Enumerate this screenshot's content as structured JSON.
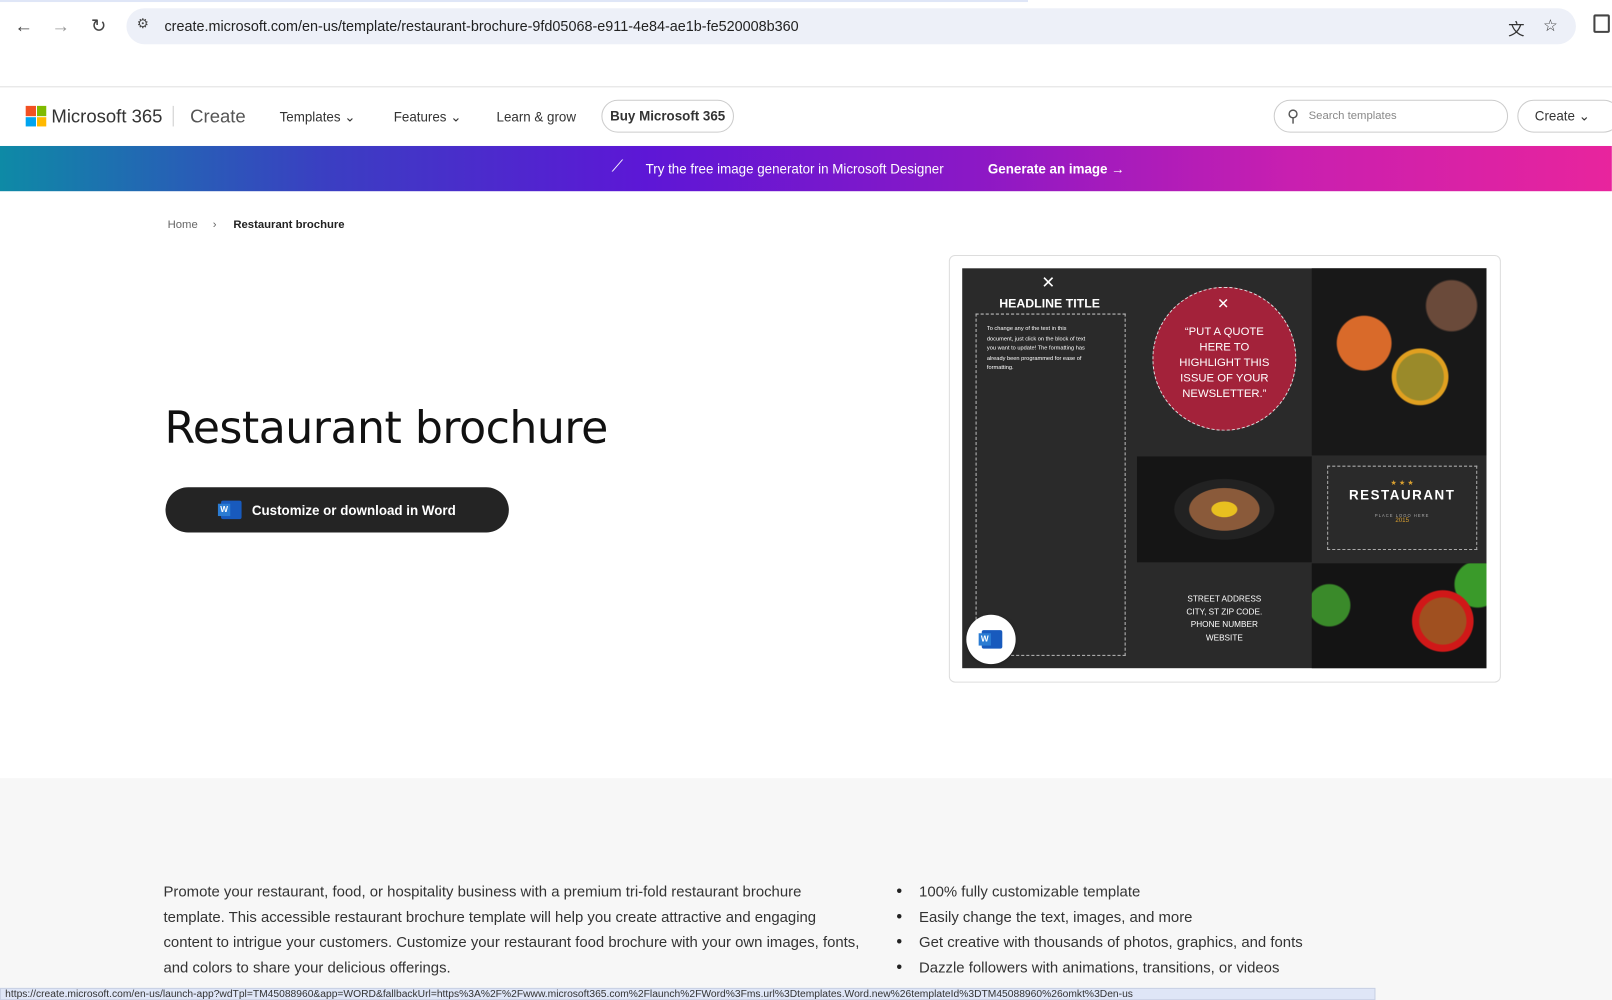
{
  "browser": {
    "url": "create.microsoft.com/en-us/template/restaurant-brochure-9fd05068-e911-4e84-ae1b-fe520008b360",
    "status_url": "https://create.microsoft.com/en-us/launch-app?wdTpl=TM45088960&app=WORD&fallbackUrl=https%3A%2F%2Fwww.microsoft365.com%2Flaunch%2FWord%3Fms.url%3Dtemplates.Word.new%26templateId%3DTM45088960%26omkt%3Den-us",
    "icons": {
      "back": "arrow-left",
      "forward": "arrow-right",
      "reload": "reload",
      "site_info": "tune",
      "translate": "translate",
      "bookmark": "star",
      "extensions": "puzzle"
    }
  },
  "nav": {
    "brand": "Microsoft 365",
    "section": "Create",
    "items": [
      {
        "label": "Templates",
        "dropdown": true
      },
      {
        "label": "Features",
        "dropdown": true
      },
      {
        "label": "Learn & grow",
        "dropdown": false
      }
    ],
    "buy_label": "Buy Microsoft 365",
    "search_placeholder": "Search templates",
    "create_label": "Create"
  },
  "banner": {
    "message": "Try the free image generator in Microsoft Designer",
    "cta": "Generate an image →"
  },
  "breadcrumb": {
    "home": "Home",
    "current": "Restaurant brochure"
  },
  "main": {
    "title": "Restaurant brochure",
    "download_label": "Customize or download in Word"
  },
  "preview": {
    "headline": "HEADLINE TITLE",
    "body": "To change any of the text in this document, just click on the block of text you want to update! The formatting has already been programmed for ease of formatting.",
    "quote": "“PUT A QUOTE HERE TO HIGHLIGHT THIS ISSUE OF YOUR NEWSLETTER.”",
    "address": [
      "STREET ADDRESS",
      "CITY, ST ZIP CODE.",
      "PHONE NUMBER",
      "WEBSITE"
    ],
    "logo_text": "RESTAURANT",
    "logo_sub": "PLACE LOGO HERE",
    "logo_year": "2015"
  },
  "description": {
    "paragraph": "Promote your restaurant, food, or hospitality business with a premium tri-fold restaurant brochure template. This accessible restaurant brochure template will help you create attractive and engaging content to intrigue your customers. Customize your restaurant food brochure with your own images, fonts, and colors to share your delicious offerings.",
    "features": [
      "100% fully customizable template",
      "Easily change the text, images, and more",
      "Get creative with thousands of photos, graphics, and fonts",
      "Dazzle followers with animations, transitions, or videos"
    ]
  },
  "colors": {
    "banner_start": "#0e8aa6",
    "banner_end": "#e8249d",
    "button": "#242424",
    "quote_circle": "#a3223a",
    "word_blue": "#185abd"
  }
}
